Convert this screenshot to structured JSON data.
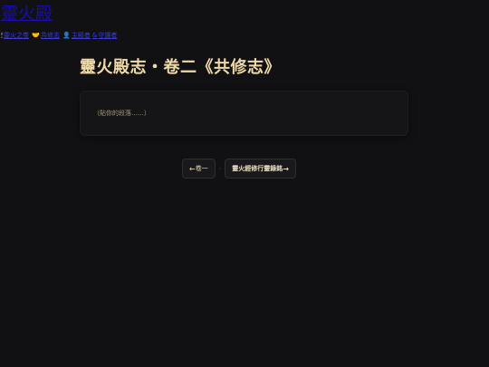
{
  "site": {
    "title": "靈火殿",
    "nav": [
      {
        "icon": "🕯",
        "icon_name": "candle-icon",
        "label": "靈火之卷"
      },
      {
        "icon": "🤝",
        "icon_name": "handshake-icon",
        "label": "共修志"
      },
      {
        "icon": "👤",
        "icon_name": "person-icon",
        "label": "主殿者",
        "label2": "守護者"
      }
    ],
    "nav_amp": "&"
  },
  "page": {
    "title": "靈火殿志・卷二《共修志》",
    "placeholder": "（貼你的段落……）"
  },
  "pager": {
    "prev_arrow": "←",
    "prev_label": "卷一",
    "separator": "·",
    "next_label": "靈火經修行靈錄銘",
    "next_arrow": "→"
  },
  "colors": {
    "background": "#111113",
    "title_gold": "#f0d9a8",
    "link_blue": "#1a0dab"
  }
}
